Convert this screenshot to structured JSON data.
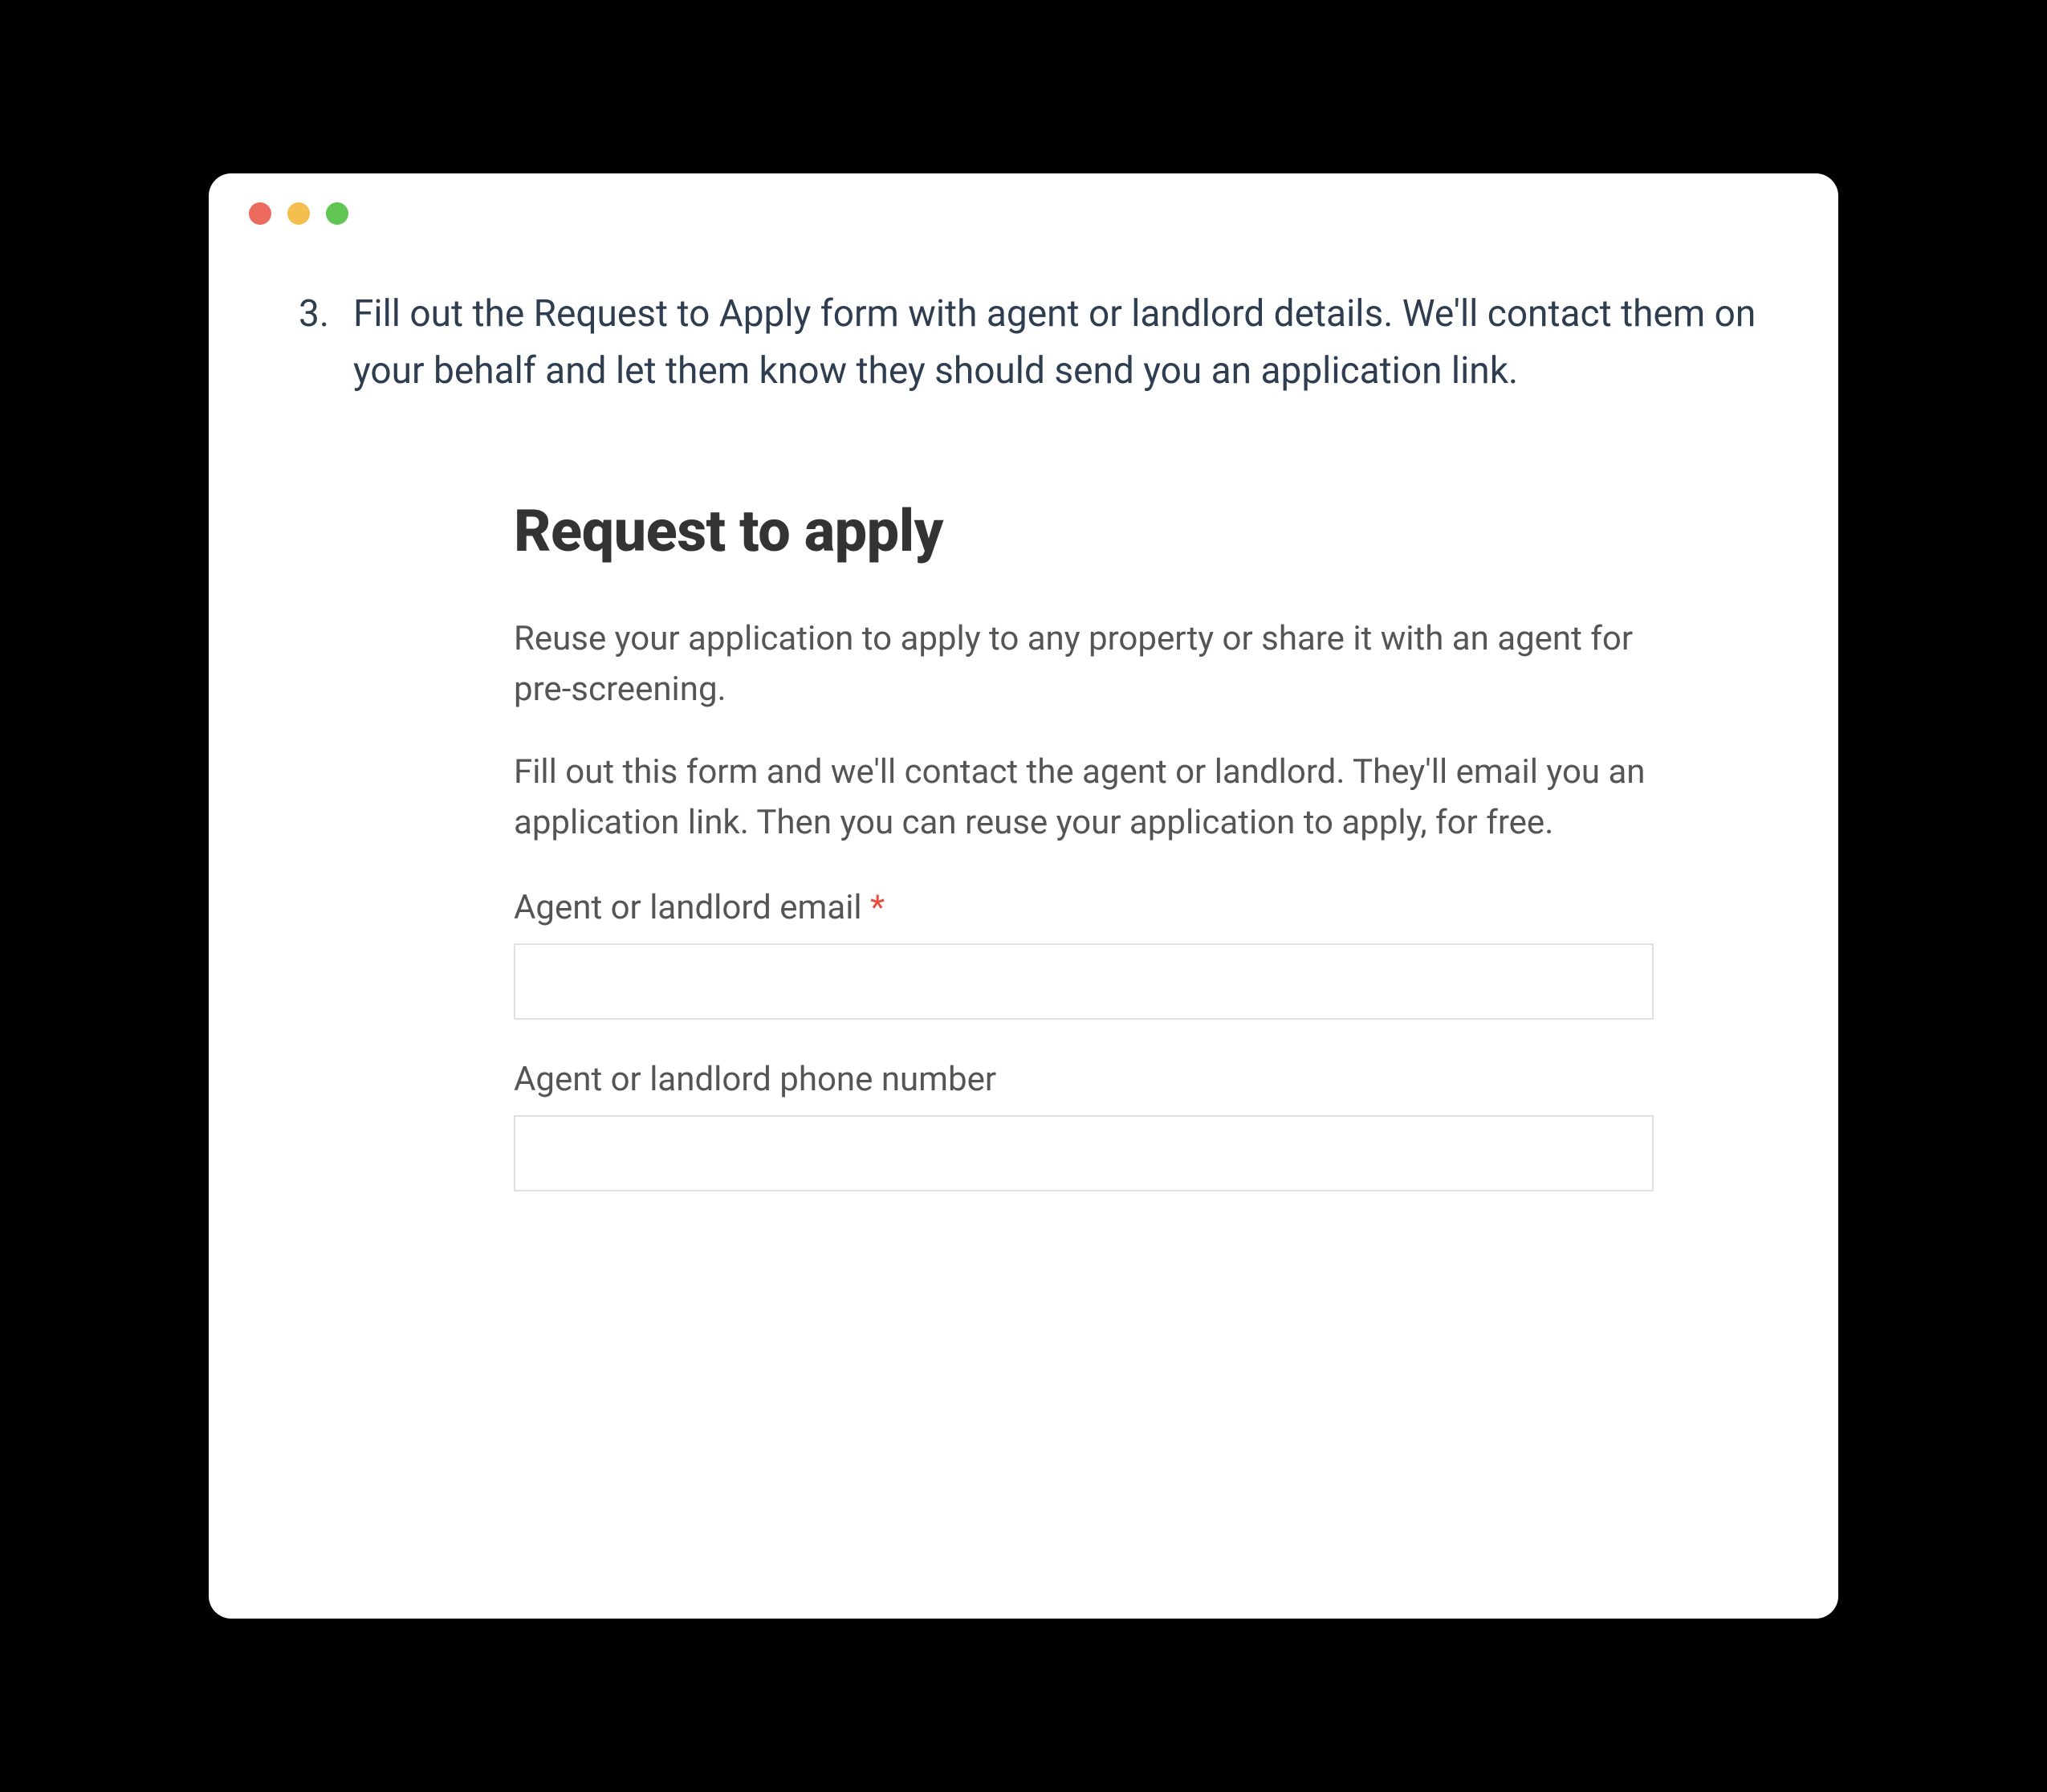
{
  "instruction": {
    "number": "3.",
    "text": "Fill out the Request to Apply form with agent or landlord details. We'll contact them on your behalf and let them know they should send you an application link."
  },
  "form": {
    "title": "Request to apply",
    "description1": "Reuse your application to apply to any property or share it with an agent for pre-screening.",
    "description2": "Fill out this form and we'll contact the agent or landlord. They'll email you an application link. Then you can reuse your application to apply, for free.",
    "fields": {
      "email": {
        "label": "Agent or landlord email ",
        "required": "*",
        "value": ""
      },
      "phone": {
        "label": "Agent or landlord phone number",
        "value": ""
      }
    }
  }
}
